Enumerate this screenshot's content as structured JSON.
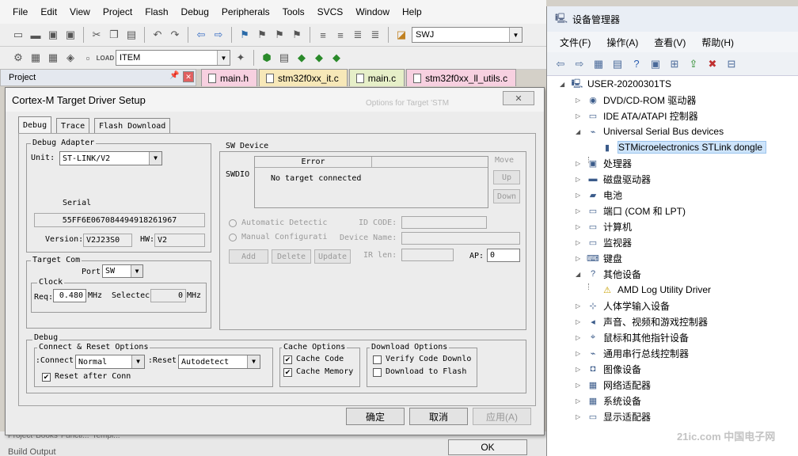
{
  "ide": {
    "menu": [
      "File",
      "Edit",
      "View",
      "Project",
      "Flash",
      "Debug",
      "Peripherals",
      "Tools",
      "SVCS",
      "Window",
      "Help"
    ],
    "target_combo": "SWJ",
    "item_combo": "ITEM",
    "project_label": "Project",
    "file_tabs": [
      {
        "label": "main.h",
        "color": "#f7d0e0"
      },
      {
        "label": "stm32f0xx_it.c",
        "color": "#f7e8b8"
      },
      {
        "label": "main.c",
        "color": "#e6efc8"
      },
      {
        "label": "stm32f0xx_ll_utils.c",
        "color": "#f7d0e0"
      }
    ],
    "bottom_tabs": [
      "Project",
      "Books",
      "Functi...",
      "Templ..."
    ],
    "build_output": "Build Output",
    "bg_dialog_title": "Options for Target 'STM",
    "bg_ok": "OK"
  },
  "dialog": {
    "title": "Cortex-M Target Driver Setup",
    "close": "✕",
    "tabs": [
      "Debug",
      "Trace",
      "Flash Download"
    ],
    "debug_adapter": {
      "title": "Debug Adapter",
      "unit_label": "Unit:",
      "unit_value": "ST-LINK/V2",
      "serial_label": "Serial",
      "serial_value": "55FF6E067084494918261967",
      "version_label": "Version:",
      "version_value": "V2J23S0",
      "hw_label": "HW:",
      "hw_value": "V2"
    },
    "target_com": {
      "title": "Target Com",
      "port_label": "Port",
      "port_value": "SW",
      "clock_title": "Clock",
      "req_label": "Req:",
      "req_value": "0.480",
      "req_unit": "MHz",
      "selected_label": "Selectec",
      "selected_value": "0",
      "selected_unit": "MHz"
    },
    "sw_device": {
      "title": "SW Device",
      "swdio": "SWDIO",
      "col_error": "Error",
      "msg": "No target connected",
      "move": "Move",
      "up": "Up",
      "down": "Down",
      "auto": "Automatic Detectic",
      "manual": "Manual Configurati",
      "id_code": "ID CODE:",
      "device_name": "Device Name:",
      "ir_len": "IR len:",
      "ap_label": "AP:",
      "ap_value": "0",
      "add": "Add",
      "delete": "Delete",
      "update": "Update"
    },
    "debug": {
      "title": "Debug",
      "cro_title": "Connect & Reset Options",
      "connect_label": "Connect:",
      "connect_value": "Normal",
      "reset_label": "Reset:",
      "reset_value": "Autodetect",
      "reset_after": "Reset after Conn",
      "cache_title": "Cache Options",
      "cache_code": "Cache Code",
      "cache_memory": "Cache Memory",
      "dl_title": "Download Options",
      "verify": "Verify Code Downlo",
      "dl_flash": "Download to Flash"
    },
    "buttons": {
      "ok": "确定",
      "cancel": "取消",
      "apply": "应用(A)"
    }
  },
  "devmgr": {
    "title": "设备管理器",
    "menu": [
      "文件(F)",
      "操作(A)",
      "查看(V)",
      "帮助(H)"
    ],
    "root": "USER-20200301TS",
    "items": [
      {
        "label": "DVD/CD-ROM 驱动器",
        "icon": "disc-icon",
        "exp": "▷",
        "indent": 0
      },
      {
        "label": "IDE ATA/ATAPI 控制器",
        "icon": "ide-icon",
        "exp": "▷",
        "indent": 0
      },
      {
        "label": "Universal Serial Bus devices",
        "icon": "usb-icon",
        "exp": "◢",
        "indent": 0
      },
      {
        "label": "STMicroelectronics STLink dongle",
        "icon": "usb-plug-icon",
        "exp": "",
        "indent": 1,
        "selected": true
      },
      {
        "label": "处理器",
        "icon": "cpu-icon",
        "exp": "▷",
        "indent": 0
      },
      {
        "label": "磁盘驱动器",
        "icon": "disk-icon",
        "exp": "▷",
        "indent": 0
      },
      {
        "label": "电池",
        "icon": "battery-icon",
        "exp": "▷",
        "indent": 0
      },
      {
        "label": "端口 (COM 和 LPT)",
        "icon": "port-icon",
        "exp": "▷",
        "indent": 0
      },
      {
        "label": "计算机",
        "icon": "computer-icon",
        "exp": "▷",
        "indent": 0
      },
      {
        "label": "监视器",
        "icon": "monitor-icon",
        "exp": "▷",
        "indent": 0
      },
      {
        "label": "键盘",
        "icon": "keyboard-icon",
        "exp": "▷",
        "indent": 0
      },
      {
        "label": "其他设备",
        "icon": "other-devices-icon",
        "exp": "◢",
        "indent": 0
      },
      {
        "label": "AMD Log Utility Driver",
        "icon": "unknown-device-icon",
        "exp": "",
        "indent": 1
      },
      {
        "label": "人体学输入设备",
        "icon": "hid-icon",
        "exp": "▷",
        "indent": 0
      },
      {
        "label": "声音、视频和游戏控制器",
        "icon": "speaker-icon",
        "exp": "▷",
        "indent": 0
      },
      {
        "label": "鼠标和其他指针设备",
        "icon": "mouse-icon",
        "exp": "▷",
        "indent": 0
      },
      {
        "label": "通用串行总线控制器",
        "icon": "usb-controller-icon",
        "exp": "▷",
        "indent": 0
      },
      {
        "label": "图像设备",
        "icon": "camera-icon",
        "exp": "▷",
        "indent": 0
      },
      {
        "label": "网络适配器",
        "icon": "network-icon",
        "exp": "▷",
        "indent": 0
      },
      {
        "label": "系统设备",
        "icon": "system-icon",
        "exp": "▷",
        "indent": 0
      },
      {
        "label": "显示适配器",
        "icon": "display-adapter-icon",
        "exp": "▷",
        "indent": 0
      }
    ]
  },
  "watermark": "21ic.com 中国电子网"
}
